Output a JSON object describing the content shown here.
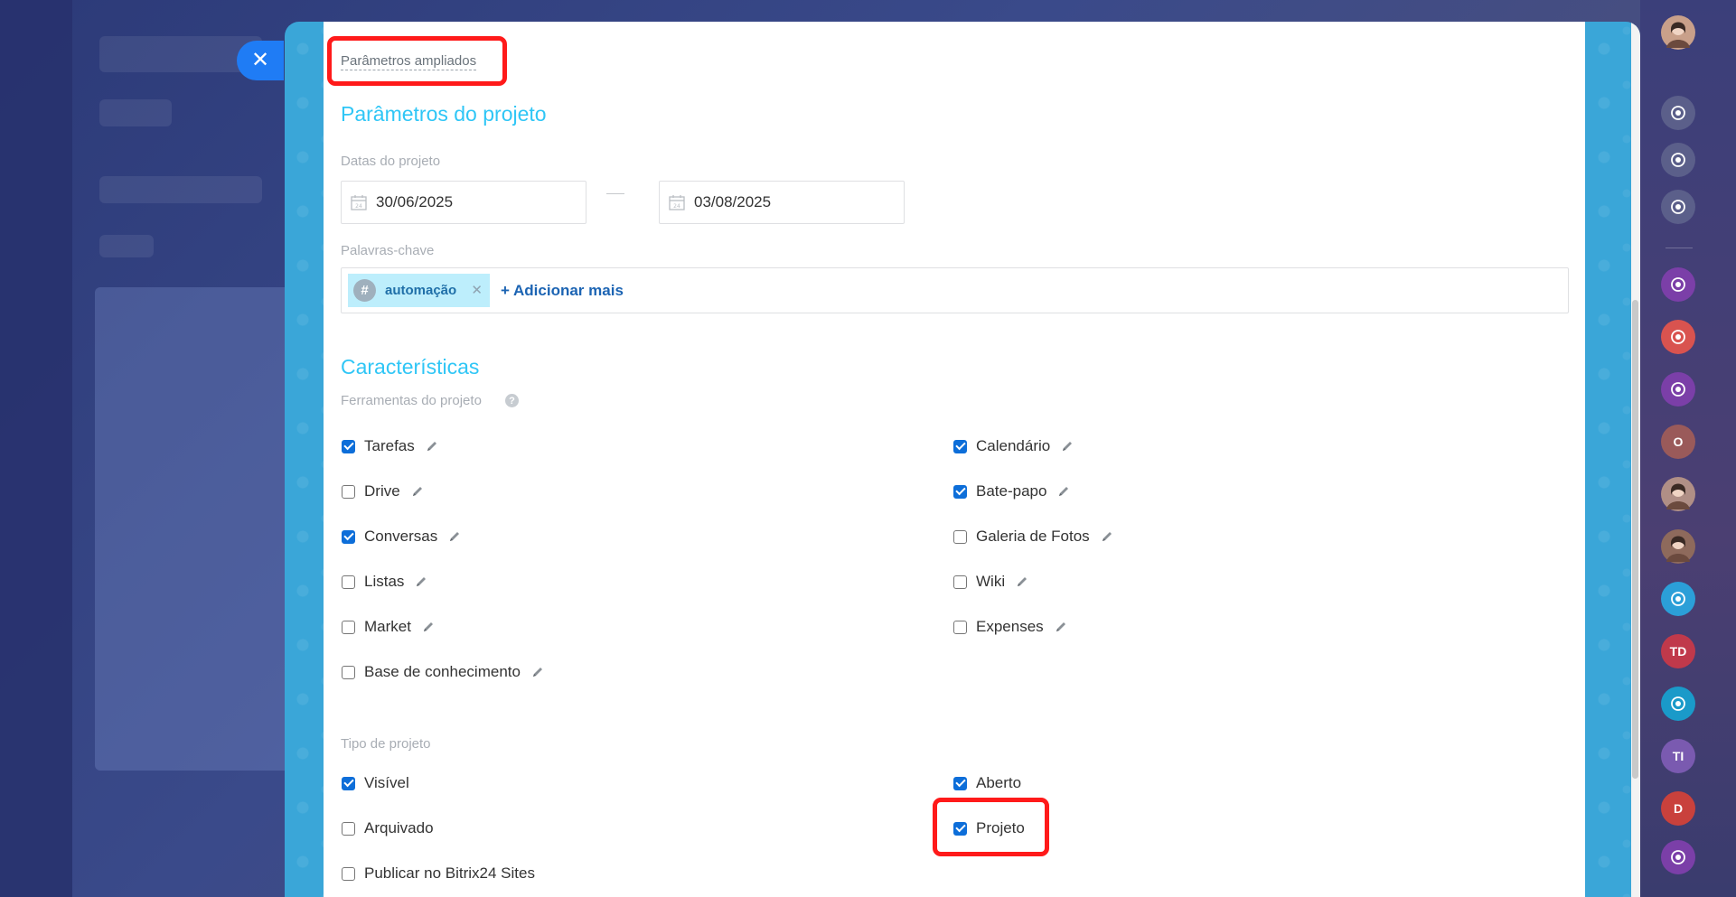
{
  "advanced_link": "Parâmetros ampliados",
  "project_params": {
    "title": "Parâmetros do projeto",
    "dates_label": "Datas do projeto",
    "start_date": "30/06/2025",
    "end_date": "03/08/2025",
    "keywords_label": "Palavras-chave",
    "tag": "automação",
    "add_more": "+ Adicionar mais"
  },
  "characteristics": {
    "title": "Características",
    "tools_label": "Ferramentas do projeto",
    "tools_left": [
      {
        "label": "Tarefas",
        "checked": true
      },
      {
        "label": "Drive",
        "checked": false
      },
      {
        "label": "Conversas",
        "checked": true
      },
      {
        "label": "Listas",
        "checked": false
      },
      {
        "label": "Market",
        "checked": false
      },
      {
        "label": "Base de conhecimento",
        "checked": false
      }
    ],
    "tools_right": [
      {
        "label": "Calendário",
        "checked": true
      },
      {
        "label": "Bate-papo",
        "checked": true
      },
      {
        "label": "Galeria de Fotos",
        "checked": false
      },
      {
        "label": "Wiki",
        "checked": false
      },
      {
        "label": "Expenses",
        "checked": false
      }
    ],
    "type_label": "Tipo de projeto",
    "type_left": [
      {
        "label": "Visível",
        "checked": true
      },
      {
        "label": "Arquivado",
        "checked": false
      },
      {
        "label": "Publicar no Bitrix24 Sites",
        "checked": false
      }
    ],
    "type_right": [
      {
        "label": "Aberto",
        "checked": true
      },
      {
        "label": "Projeto",
        "checked": true
      }
    ]
  },
  "right_bar": {
    "avatars": [
      {
        "type": "photo",
        "color": "#c9a08a"
      },
      {
        "type": "bell-icon",
        "color": "#5b5f8a"
      },
      {
        "type": "target-icon",
        "color": "#5b5f8a"
      },
      {
        "type": "sync-icon",
        "color": "#5b5f8a"
      },
      {
        "type": "group-icon",
        "color": "#7b3fa8"
      },
      {
        "type": "people-icon",
        "color": "#d9534f"
      },
      {
        "type": "group-icon",
        "color": "#7b3fa8"
      },
      {
        "type": "text",
        "text": "O",
        "color": "#9a5a5a"
      },
      {
        "type": "photo",
        "color": "#b08f86"
      },
      {
        "type": "photo",
        "color": "#8e6a5c"
      },
      {
        "type": "chat-icon",
        "color": "#2b9fd8"
      },
      {
        "type": "text",
        "text": "TD",
        "color": "#c0394b"
      },
      {
        "type": "bookmark-icon",
        "color": "#1a9ac9"
      },
      {
        "type": "text",
        "text": "TI",
        "color": "#7a5ab0"
      },
      {
        "type": "text",
        "text": "D",
        "color": "#c9413c"
      },
      {
        "type": "group-icon",
        "color": "#7b3fa8"
      }
    ]
  }
}
